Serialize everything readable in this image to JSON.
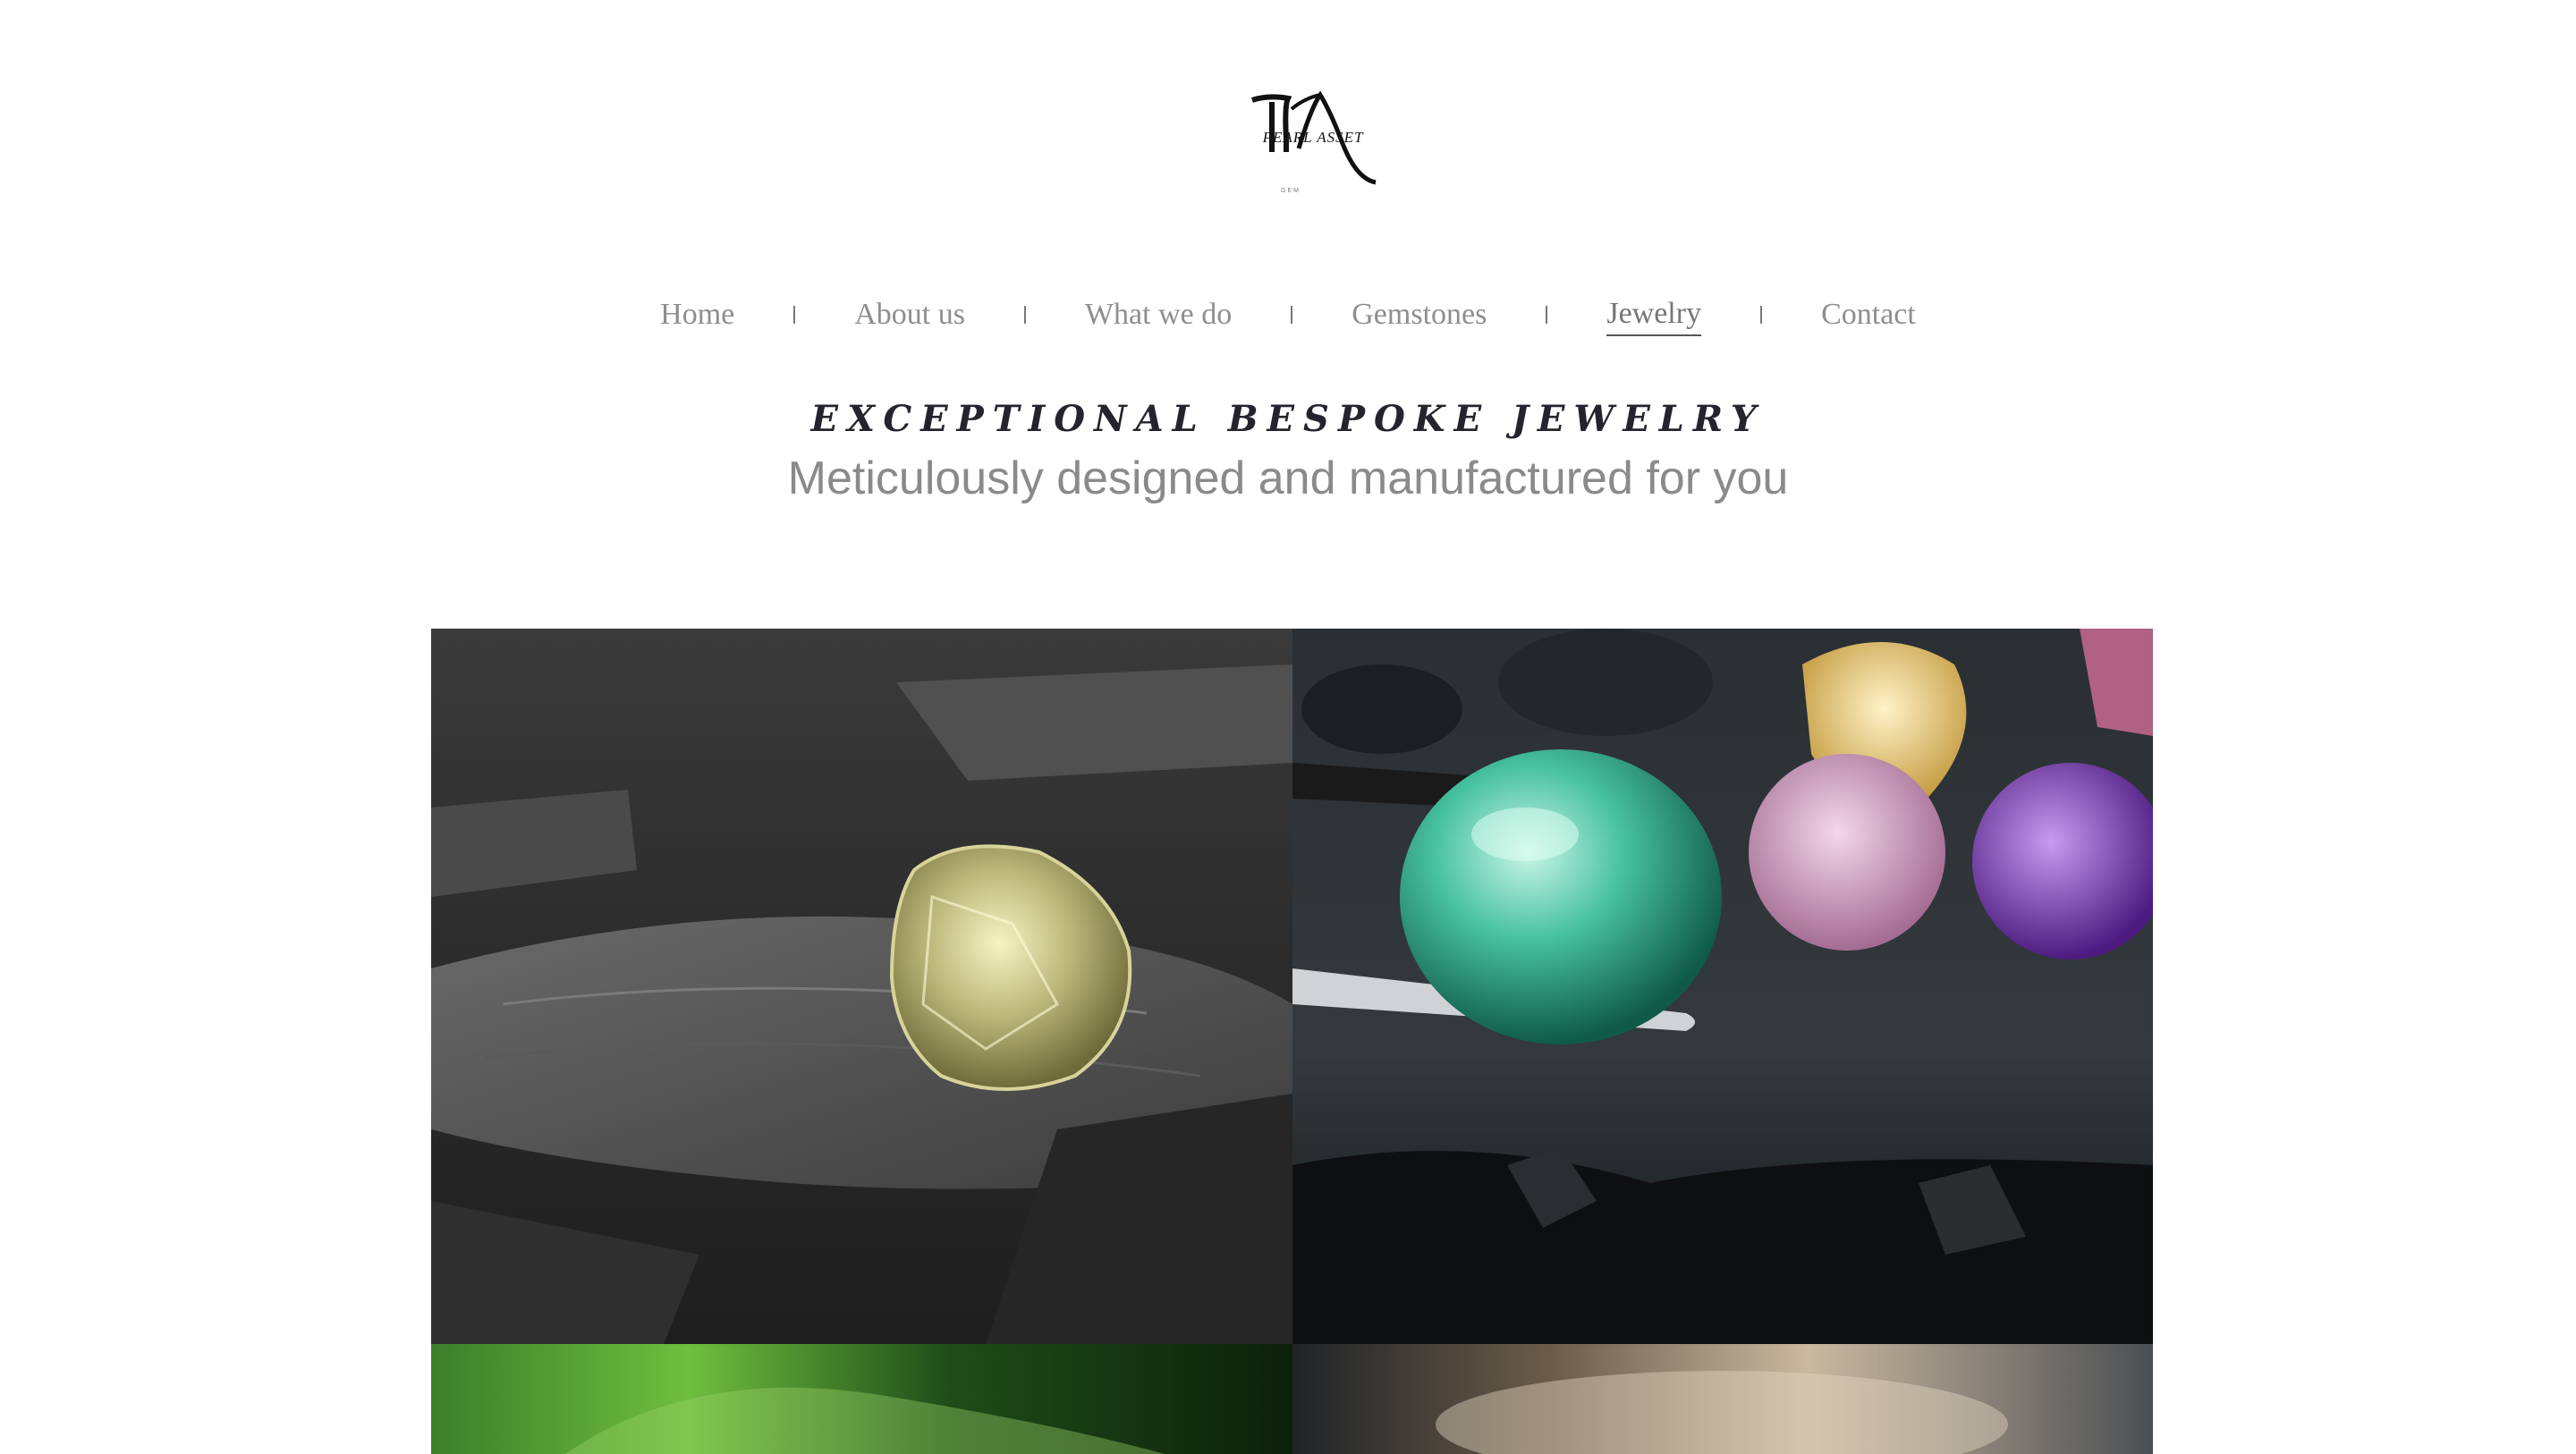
{
  "brand": {
    "monogram": "PA",
    "name": "PEARL ASSET",
    "sub": "GEM"
  },
  "nav": {
    "items": [
      {
        "label": "Home"
      },
      {
        "label": "About us"
      },
      {
        "label": "What we do"
      },
      {
        "label": "Gemstones"
      },
      {
        "label": "Jewelry"
      },
      {
        "label": "Contact"
      }
    ],
    "active": "Jewelry"
  },
  "hero": {
    "tagline": "Exceptional Bespoke Jewelry",
    "subtitle": "Meticulously designed and manufactured for you"
  },
  "gallery": {
    "images": [
      {
        "name": "yellow-gemstone-on-rock"
      },
      {
        "name": "green-gemstone-in-tweezers"
      },
      {
        "name": "green-abstract-image"
      },
      {
        "name": "smoky-brown-image"
      }
    ]
  },
  "colors": {
    "nav_text": "#8e8e8e",
    "tagline": "#24242e",
    "subtitle": "#8a8a8a",
    "background": "#ffffff"
  }
}
